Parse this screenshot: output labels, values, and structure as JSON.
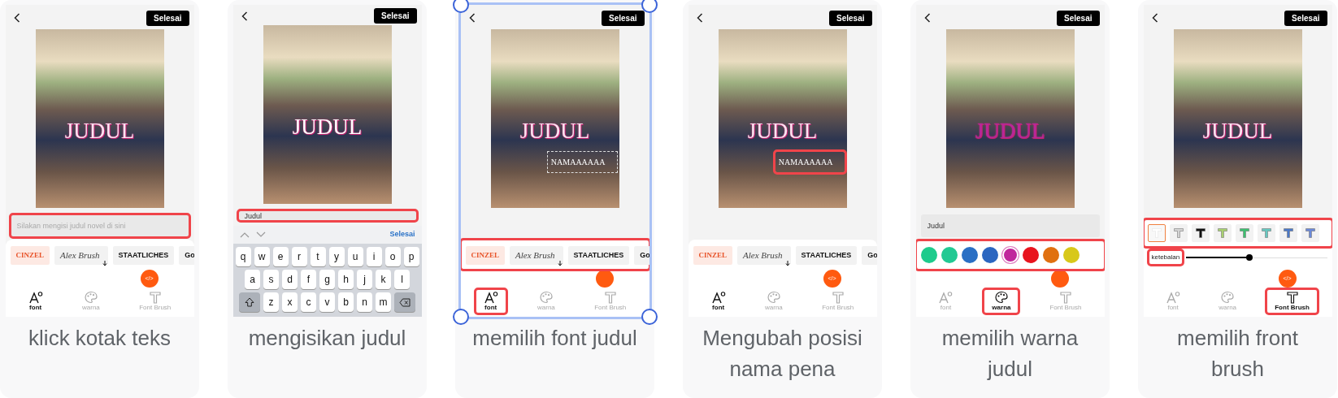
{
  "steps": [
    {
      "kind": "font",
      "caption": "klick kotak teks",
      "done": "Selesai",
      "title": {
        "text": "JUDUL",
        "color": "#fbe3f1"
      },
      "input": {
        "placeholder": "Silakan mengisi judul novel di sini",
        "highlighted": true
      },
      "fonts": {
        "items": [
          {
            "label": "CINZEL",
            "selected": true
          },
          {
            "label": "Alex Brush",
            "selected": false
          },
          {
            "label": "STAATLICHES",
            "selected": false
          },
          {
            "label": "Go",
            "selected": false
          }
        ]
      },
      "fab_label": "</>",
      "tabs": [
        {
          "label": "font",
          "selected": true,
          "highlighted": false
        },
        {
          "label": "warna",
          "selected": false,
          "highlighted": false
        },
        {
          "label": "Font Brush",
          "selected": false,
          "highlighted": false
        }
      ]
    },
    {
      "kind": "keyboard",
      "caption": "mengisikan judul",
      "done": "Selesai",
      "title": {
        "text": "JUDUL",
        "color": "#ffffff"
      },
      "input": {
        "value": "Judul",
        "highlighted": true
      },
      "keyboard": {
        "done": "Selesai",
        "rows": [
          [
            "q",
            "w",
            "e",
            "r",
            "t",
            "y",
            "u",
            "i",
            "o",
            "p"
          ],
          [
            "a",
            "s",
            "d",
            "f",
            "g",
            "h",
            "j",
            "k",
            "l"
          ],
          [
            "z",
            "x",
            "c",
            "v",
            "b",
            "n",
            "m"
          ]
        ]
      }
    },
    {
      "kind": "font",
      "caption": "memilih font judul",
      "done": "Selesai",
      "title": {
        "text": "JUDUL",
        "color": "#fbe3f1"
      },
      "selection_frame": true,
      "pen_name": {
        "text": "NAMAAAAAA",
        "highlighted": false
      },
      "fonts": {
        "highlighted": true,
        "items": [
          {
            "label": "CINZEL",
            "selected": true
          },
          {
            "label": "Alex Brush",
            "selected": false
          },
          {
            "label": "STAATLICHES",
            "selected": false
          },
          {
            "label": "Go",
            "selected": false
          }
        ]
      },
      "tabs": [
        {
          "label": "font",
          "selected": true,
          "highlighted": true
        },
        {
          "label": "warna",
          "selected": false,
          "highlighted": false
        },
        {
          "label": "Font Brush",
          "selected": false,
          "highlighted": false
        }
      ]
    },
    {
      "kind": "font",
      "caption": "Mengubah posisi nama pena",
      "done": "Selesai",
      "title": {
        "text": "JUDUL",
        "color": "#fbe3f1"
      },
      "pen_name": {
        "text": "NAMAAAAAA",
        "highlighted": true
      },
      "fonts": {
        "items": [
          {
            "label": "CINZEL",
            "selected": true
          },
          {
            "label": "Alex Brush",
            "selected": false
          },
          {
            "label": "STAATLICHES",
            "selected": false
          },
          {
            "label": "Go",
            "selected": false
          }
        ]
      },
      "fab_label": "</>",
      "tabs": [
        {
          "label": "font",
          "selected": true,
          "highlighted": false
        },
        {
          "label": "warna",
          "selected": false,
          "highlighted": false
        },
        {
          "label": "Font Brush",
          "selected": false,
          "highlighted": false
        }
      ]
    },
    {
      "kind": "color",
      "caption": "memilih warna judul",
      "done": "Selesai",
      "title": {
        "text": "JUDUL",
        "color": "#b8269a"
      },
      "input": {
        "value": "Judul",
        "highlighted": false
      },
      "swatches": {
        "highlighted": true,
        "items": [
          {
            "color": "#1ecb8c",
            "selected": false
          },
          {
            "color": "#22c993",
            "selected": false
          },
          {
            "color": "#2a6fc4",
            "selected": false
          },
          {
            "color": "#2b66c0",
            "selected": false
          },
          {
            "color": "#c0289c",
            "selected": true
          },
          {
            "color": "#e8141e",
            "selected": false
          },
          {
            "color": "#e07010",
            "selected": false
          },
          {
            "color": "#d8c81a",
            "selected": false
          }
        ]
      },
      "tabs": [
        {
          "label": "font",
          "selected": false,
          "highlighted": false
        },
        {
          "label": "warna",
          "selected": true,
          "highlighted": true
        },
        {
          "label": "Font Brush",
          "selected": false,
          "highlighted": false
        }
      ]
    },
    {
      "kind": "brush",
      "caption": "memilih front brush",
      "done": "Selesai",
      "title": {
        "text": "JUDUL",
        "color": "#fbe3f1"
      },
      "brushes": {
        "highlighted": true,
        "items": [
          {
            "color": "#ffffff",
            "selected": true
          },
          {
            "color": "#d4d4d4",
            "selected": false
          },
          {
            "color": "#111111",
            "selected": false
          },
          {
            "color": "#a8d070",
            "selected": false
          },
          {
            "color": "#3cc070",
            "selected": false
          },
          {
            "color": "#66c8c0",
            "selected": false
          },
          {
            "color": "#4a78c8",
            "selected": false
          },
          {
            "color": "#6a88d8",
            "selected": false
          }
        ]
      },
      "thickness": {
        "label": "ketebalan",
        "level": 0.45,
        "highlighted": true
      },
      "fab_label": "</>",
      "tabs": [
        {
          "label": "font",
          "selected": false,
          "highlighted": false
        },
        {
          "label": "warna",
          "selected": false,
          "highlighted": false
        },
        {
          "label": "Font Brush",
          "selected": true,
          "highlighted": true
        }
      ]
    }
  ]
}
